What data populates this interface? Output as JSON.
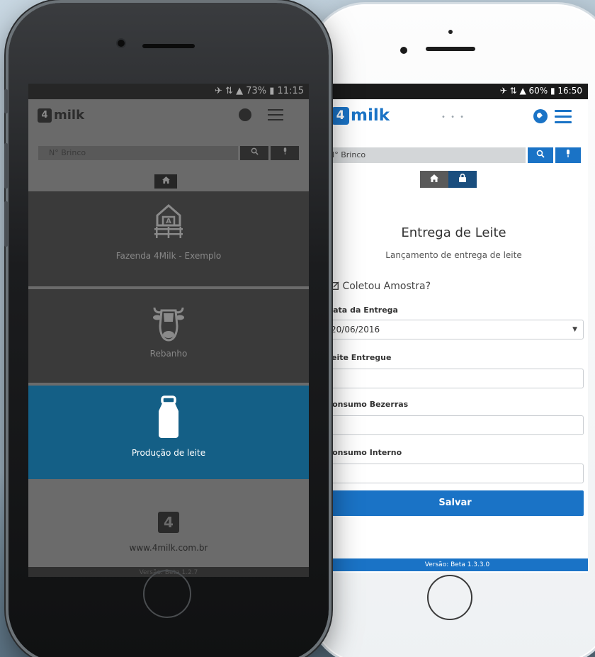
{
  "left_phone": {
    "status_bar": "✈ ⇅ ▲ 73% ▮ 11:15",
    "app_logo_mark": "4",
    "app_logo_text": "milk",
    "search_placeholder": "N° Brinco",
    "menu_tiles": [
      {
        "label": "Fazenda  4Milk - Exemplo"
      },
      {
        "label": "Rebanho"
      },
      {
        "label": "Produção de leite"
      },
      {
        "label": "www.4milk.com.br"
      }
    ],
    "version": "Versão: Beta 1.2.7",
    "colors": {
      "active_tile": "#145f86",
      "tile": "#3a3a3a"
    }
  },
  "right_phone": {
    "status_bar": "✈ ⇅ ▲ 60% ▮ 16:50",
    "app_logo_mark": "4",
    "app_logo_text": "milk",
    "header_dots": "• • •",
    "search_placeholder": "N° Brinco",
    "form": {
      "title": "Entrega de Leite",
      "subtitle": "Lançamento de entrega de leite",
      "checkbox_label": "Coletou Amostra?",
      "date_label": "Data da Entrega",
      "date_value": "20/06/2016",
      "delivered_label": "Leite Entregue",
      "delivered_value": "",
      "calves_label": "Consumo Bezerras",
      "calves_value": "",
      "internal_label": "Consumo Interno",
      "internal_value": "",
      "save_label": "Salvar"
    },
    "version": "Versão: Beta 1.3.3.0",
    "colors": {
      "brand": "#1a73c6"
    }
  }
}
